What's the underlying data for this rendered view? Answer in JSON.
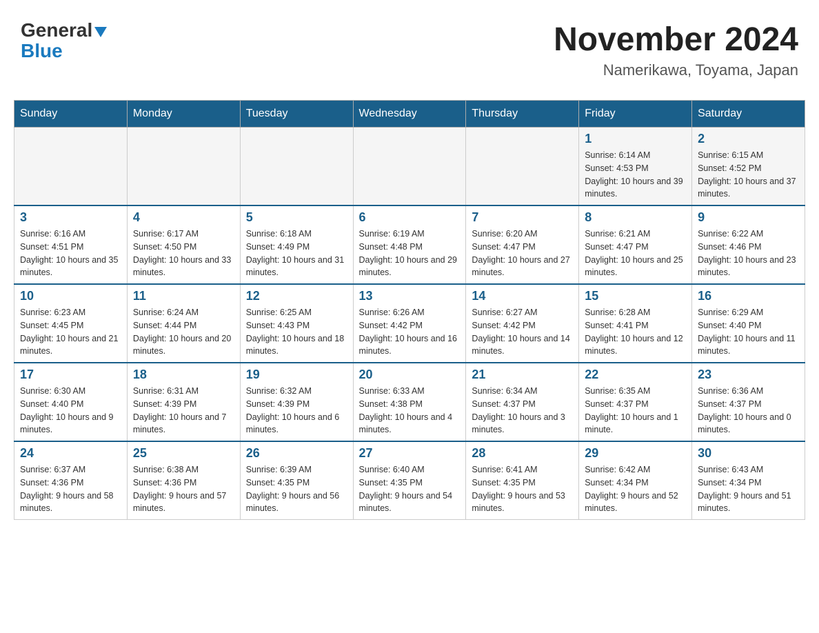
{
  "header": {
    "logo_general": "General",
    "logo_blue": "Blue",
    "month_title": "November 2024",
    "location": "Namerikawa, Toyama, Japan"
  },
  "days_of_week": [
    "Sunday",
    "Monday",
    "Tuesday",
    "Wednesday",
    "Thursday",
    "Friday",
    "Saturday"
  ],
  "weeks": [
    [
      {
        "day": "",
        "info": ""
      },
      {
        "day": "",
        "info": ""
      },
      {
        "day": "",
        "info": ""
      },
      {
        "day": "",
        "info": ""
      },
      {
        "day": "",
        "info": ""
      },
      {
        "day": "1",
        "info": "Sunrise: 6:14 AM\nSunset: 4:53 PM\nDaylight: 10 hours and 39 minutes."
      },
      {
        "day": "2",
        "info": "Sunrise: 6:15 AM\nSunset: 4:52 PM\nDaylight: 10 hours and 37 minutes."
      }
    ],
    [
      {
        "day": "3",
        "info": "Sunrise: 6:16 AM\nSunset: 4:51 PM\nDaylight: 10 hours and 35 minutes."
      },
      {
        "day": "4",
        "info": "Sunrise: 6:17 AM\nSunset: 4:50 PM\nDaylight: 10 hours and 33 minutes."
      },
      {
        "day": "5",
        "info": "Sunrise: 6:18 AM\nSunset: 4:49 PM\nDaylight: 10 hours and 31 minutes."
      },
      {
        "day": "6",
        "info": "Sunrise: 6:19 AM\nSunset: 4:48 PM\nDaylight: 10 hours and 29 minutes."
      },
      {
        "day": "7",
        "info": "Sunrise: 6:20 AM\nSunset: 4:47 PM\nDaylight: 10 hours and 27 minutes."
      },
      {
        "day": "8",
        "info": "Sunrise: 6:21 AM\nSunset: 4:47 PM\nDaylight: 10 hours and 25 minutes."
      },
      {
        "day": "9",
        "info": "Sunrise: 6:22 AM\nSunset: 4:46 PM\nDaylight: 10 hours and 23 minutes."
      }
    ],
    [
      {
        "day": "10",
        "info": "Sunrise: 6:23 AM\nSunset: 4:45 PM\nDaylight: 10 hours and 21 minutes."
      },
      {
        "day": "11",
        "info": "Sunrise: 6:24 AM\nSunset: 4:44 PM\nDaylight: 10 hours and 20 minutes."
      },
      {
        "day": "12",
        "info": "Sunrise: 6:25 AM\nSunset: 4:43 PM\nDaylight: 10 hours and 18 minutes."
      },
      {
        "day": "13",
        "info": "Sunrise: 6:26 AM\nSunset: 4:42 PM\nDaylight: 10 hours and 16 minutes."
      },
      {
        "day": "14",
        "info": "Sunrise: 6:27 AM\nSunset: 4:42 PM\nDaylight: 10 hours and 14 minutes."
      },
      {
        "day": "15",
        "info": "Sunrise: 6:28 AM\nSunset: 4:41 PM\nDaylight: 10 hours and 12 minutes."
      },
      {
        "day": "16",
        "info": "Sunrise: 6:29 AM\nSunset: 4:40 PM\nDaylight: 10 hours and 11 minutes."
      }
    ],
    [
      {
        "day": "17",
        "info": "Sunrise: 6:30 AM\nSunset: 4:40 PM\nDaylight: 10 hours and 9 minutes."
      },
      {
        "day": "18",
        "info": "Sunrise: 6:31 AM\nSunset: 4:39 PM\nDaylight: 10 hours and 7 minutes."
      },
      {
        "day": "19",
        "info": "Sunrise: 6:32 AM\nSunset: 4:39 PM\nDaylight: 10 hours and 6 minutes."
      },
      {
        "day": "20",
        "info": "Sunrise: 6:33 AM\nSunset: 4:38 PM\nDaylight: 10 hours and 4 minutes."
      },
      {
        "day": "21",
        "info": "Sunrise: 6:34 AM\nSunset: 4:37 PM\nDaylight: 10 hours and 3 minutes."
      },
      {
        "day": "22",
        "info": "Sunrise: 6:35 AM\nSunset: 4:37 PM\nDaylight: 10 hours and 1 minute."
      },
      {
        "day": "23",
        "info": "Sunrise: 6:36 AM\nSunset: 4:37 PM\nDaylight: 10 hours and 0 minutes."
      }
    ],
    [
      {
        "day": "24",
        "info": "Sunrise: 6:37 AM\nSunset: 4:36 PM\nDaylight: 9 hours and 58 minutes."
      },
      {
        "day": "25",
        "info": "Sunrise: 6:38 AM\nSunset: 4:36 PM\nDaylight: 9 hours and 57 minutes."
      },
      {
        "day": "26",
        "info": "Sunrise: 6:39 AM\nSunset: 4:35 PM\nDaylight: 9 hours and 56 minutes."
      },
      {
        "day": "27",
        "info": "Sunrise: 6:40 AM\nSunset: 4:35 PM\nDaylight: 9 hours and 54 minutes."
      },
      {
        "day": "28",
        "info": "Sunrise: 6:41 AM\nSunset: 4:35 PM\nDaylight: 9 hours and 53 minutes."
      },
      {
        "day": "29",
        "info": "Sunrise: 6:42 AM\nSunset: 4:34 PM\nDaylight: 9 hours and 52 minutes."
      },
      {
        "day": "30",
        "info": "Sunrise: 6:43 AM\nSunset: 4:34 PM\nDaylight: 9 hours and 51 minutes."
      }
    ]
  ]
}
